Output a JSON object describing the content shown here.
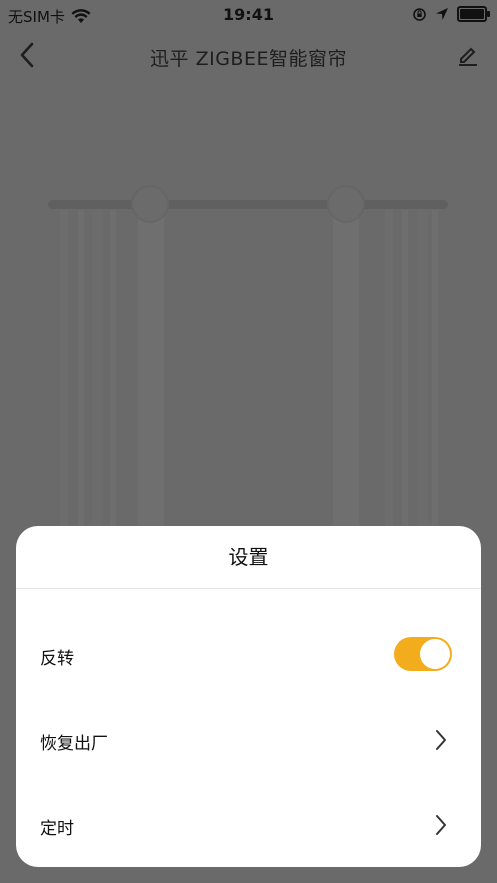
{
  "status_bar": {
    "carrier": "无SIM卡",
    "time": "19:41",
    "wifi_icon": "wifi-icon",
    "lock_icon": "orientation-lock-icon",
    "location_icon": "location-arrow-icon",
    "battery_icon": "battery-icon"
  },
  "nav": {
    "title": "迅平 ZIGBEE智能窗帘",
    "back_icon": "chevron-left-icon",
    "edit_icon": "pencil-icon"
  },
  "sheet": {
    "title": "设置",
    "rows": [
      {
        "label": "反转",
        "control": "toggle",
        "on": true
      },
      {
        "label": "恢复出厂",
        "control": "chevron"
      },
      {
        "label": "定时",
        "control": "chevron"
      }
    ]
  },
  "colors": {
    "accent": "#f3ac1c",
    "overlay_bg": "#6a6a6a"
  }
}
